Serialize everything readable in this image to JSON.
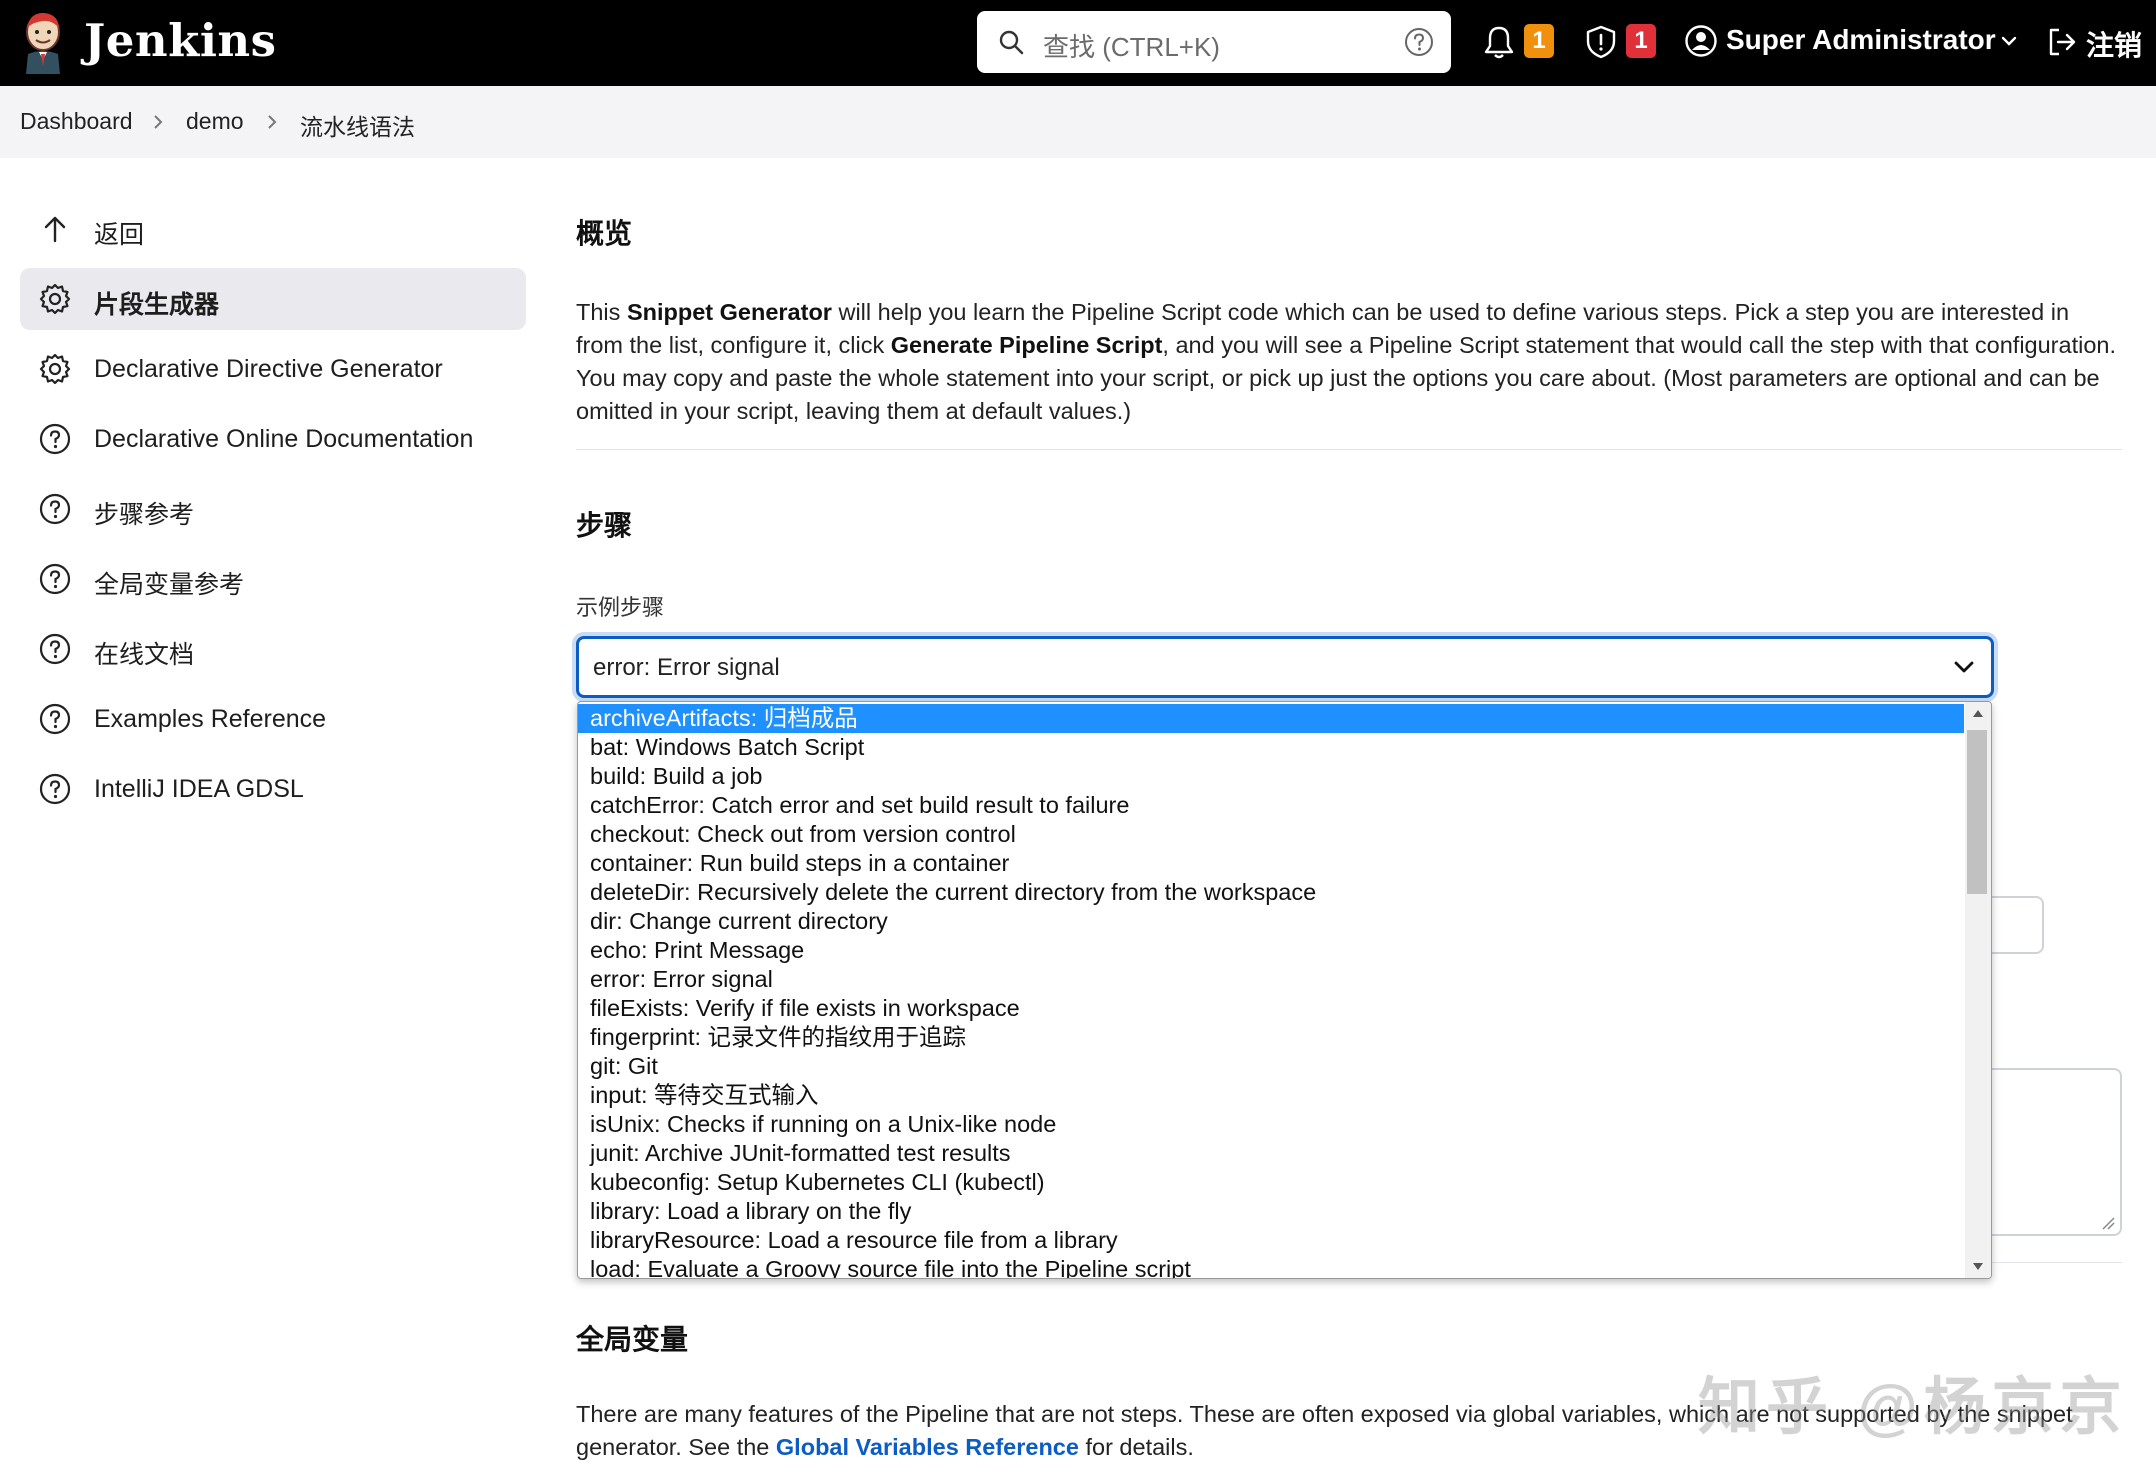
{
  "header": {
    "brand": "Jenkins",
    "search_placeholder": "查找 (CTRL+K)",
    "notifications_count": "1",
    "security_count": "1",
    "user_name": "Super Administrator",
    "logout_label": "注销",
    "colors": {
      "bar": "#000000",
      "notification_badge": "#f0900c",
      "security_badge": "#e0303a"
    }
  },
  "breadcrumb": [
    "Dashboard",
    "demo",
    "流水线语法"
  ],
  "sidebar": {
    "items": [
      {
        "label": "返回",
        "icon": "arrow-up-icon"
      },
      {
        "label": "片段生成器",
        "icon": "gear-icon",
        "active": true
      },
      {
        "label": "Declarative Directive Generator",
        "icon": "gear-icon"
      },
      {
        "label": "Declarative Online Documentation",
        "icon": "help-circle-icon"
      },
      {
        "label": "步骤参考",
        "icon": "help-circle-icon"
      },
      {
        "label": "全局变量参考",
        "icon": "help-circle-icon"
      },
      {
        "label": "在线文档",
        "icon": "help-circle-icon"
      },
      {
        "label": "Examples Reference",
        "icon": "help-circle-icon"
      },
      {
        "label": "IntelliJ IDEA GDSL",
        "icon": "help-circle-icon"
      }
    ]
  },
  "main": {
    "overview_title": "概览",
    "overview_text": {
      "t1": "This ",
      "b1": "Snippet Generator",
      "t2": " will help you learn the Pipeline Script code which can be used to define various steps. Pick a step you are interested in from the list, configure it, click ",
      "b2": "Generate Pipeline Script",
      "t3": ", and you will see a Pipeline Script statement that would call the step with that configuration. You may copy and paste the whole statement into your script, or pick up just the options you care about. (Most parameters are optional and can be omitted in your script, leaving them at default values.)"
    },
    "steps_title": "步骤",
    "sample_step_label": "示例步骤",
    "selected_step": "error: Error signal",
    "step_options": [
      "archiveArtifacts: 归档成品",
      "bat: Windows Batch Script",
      "build: Build a job",
      "catchError: Catch error and set build result to failure",
      "checkout: Check out from version control",
      "container: Run build steps in a container",
      "deleteDir: Recursively delete the current directory from the workspace",
      "dir: Change current directory",
      "echo: Print Message",
      "error: Error signal",
      "fileExists: Verify if file exists in workspace",
      "fingerprint: 记录文件的指纹用于追踪",
      "git: Git",
      "input: 等待交互式输入",
      "isUnix: Checks if running on a Unix-like node",
      "junit: Archive JUnit-formatted test results",
      "kubeconfig: Setup Kubernetes CLI (kubectl)",
      "library: Load a library on the fly",
      "libraryResource: Load a resource file from a library",
      "load: Evaluate a Groovy source file into the Pipeline script"
    ],
    "highlighted_option_index": 0,
    "globals_title": "全局变量",
    "globals_text": {
      "t1": "There are many features of the Pipeline that are not steps. These are often exposed via global variables, which are not supported by the snippet generator. See the ",
      "link": "Global Variables Reference",
      "t2": " for details."
    }
  },
  "watermark": "知乎 @杨京京"
}
